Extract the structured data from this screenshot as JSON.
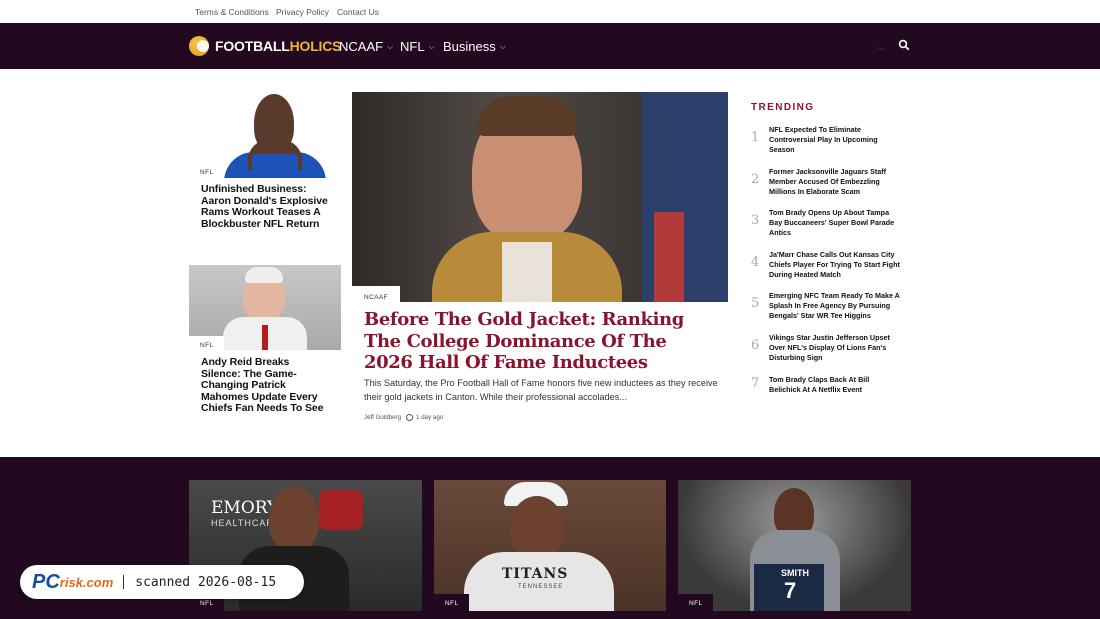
{
  "topbar": {
    "links": [
      "Terms & Conditions",
      "Privacy Policy",
      "Contact Us"
    ]
  },
  "nav": {
    "logo_part1": "FOOTBALL",
    "logo_part2": "HOLICS",
    "items": [
      "NCAAF",
      "NFL",
      "Business"
    ],
    "theme_icon": "moon-icon",
    "search_icon": "search-icon"
  },
  "side_stories": [
    {
      "category": "NFL",
      "title": "Unfinished Business: Aaron Donald's Explosive Rams Workout Teases A Blockbuster NFL Return"
    },
    {
      "category": "NFL",
      "title": "Andy Reid Breaks Silence: The Game-Changing Patrick Mahomes Update Every Chiefs Fan Needs To See"
    }
  ],
  "feature": {
    "category": "NCAAF",
    "title": "Before The Gold Jacket: Ranking The College Dominance Of The 2026 Hall Of Fame Inductees",
    "excerpt": "This Saturday, the Pro Football Hall of Fame honors five new inductees as they receive their gold jackets in Canton. While their professional accolades...",
    "author": "Jeff Goldberg",
    "time": "1 day ago"
  },
  "trending": {
    "heading": "TRENDING",
    "items": [
      {
        "num": "1",
        "title": "NFL Expected To Eliminate Controversial Play In Upcoming Season"
      },
      {
        "num": "2",
        "title": "Former Jacksonville Jaguars Staff Member Accused Of Embezzling Millions In Elaborate Scam"
      },
      {
        "num": "3",
        "title": "Tom Brady Opens Up About Tampa Bay Buccaneers' Super Bowl Parade Antics"
      },
      {
        "num": "4",
        "title": "Ja'Marr Chase Calls Out Kansas City Chiefs Player For Trying To Start Fight During Heated Match"
      },
      {
        "num": "5",
        "title": "Emerging NFC Team Ready To Make A Splash In Free Agency By Pursuing Bengals' Star WR Tee Higgins"
      },
      {
        "num": "6",
        "title": "Vikings Star Justin Jefferson Upset Over NFL's Display Of Lions Fan's Disturbing Sign"
      },
      {
        "num": "7",
        "title": "Tom Brady Claps Back At Bill Belichick At A Netflix Event"
      }
    ]
  },
  "bottom_cards": [
    {
      "category": "NFL",
      "img_text_1": "EMORY",
      "img_text_2": "HEALTHCARE"
    },
    {
      "category": "NFL",
      "img_text_1": "TITANS",
      "img_text_2": "TENNESSEE"
    },
    {
      "category": "NFL",
      "img_text_1": "SMITH",
      "img_text_2": "7"
    }
  ],
  "watermark": {
    "logo_pc": "PC",
    "logo_risk": "risk.com",
    "text": "scanned 2026-08-15"
  },
  "colors": {
    "nav_bg": "#22091f",
    "accent": "#8a1430",
    "logo_gold": "#f2b13a"
  }
}
